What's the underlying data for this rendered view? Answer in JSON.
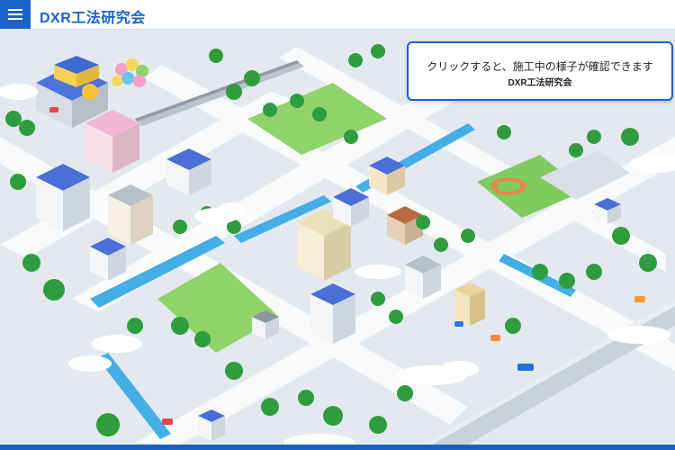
{
  "header": {
    "title": "DXR工法研究会",
    "menu_icon": "hamburger-menu-icon",
    "accent_color": "#1a63c9"
  },
  "info_box": {
    "message": "クリックすると、施工中の様子が確認できます",
    "org": "DXR工法研究会"
  },
  "map": {
    "description_icon": "isometric-city-map",
    "colors": {
      "road": "#f5f7f9",
      "ground": "#dfe6ec",
      "park": "#8fd16a",
      "river": "#3fa7e0",
      "tree": "#2f9d3f",
      "roof_blue": "#4a6fd6",
      "cloud": "#ffffff"
    }
  }
}
